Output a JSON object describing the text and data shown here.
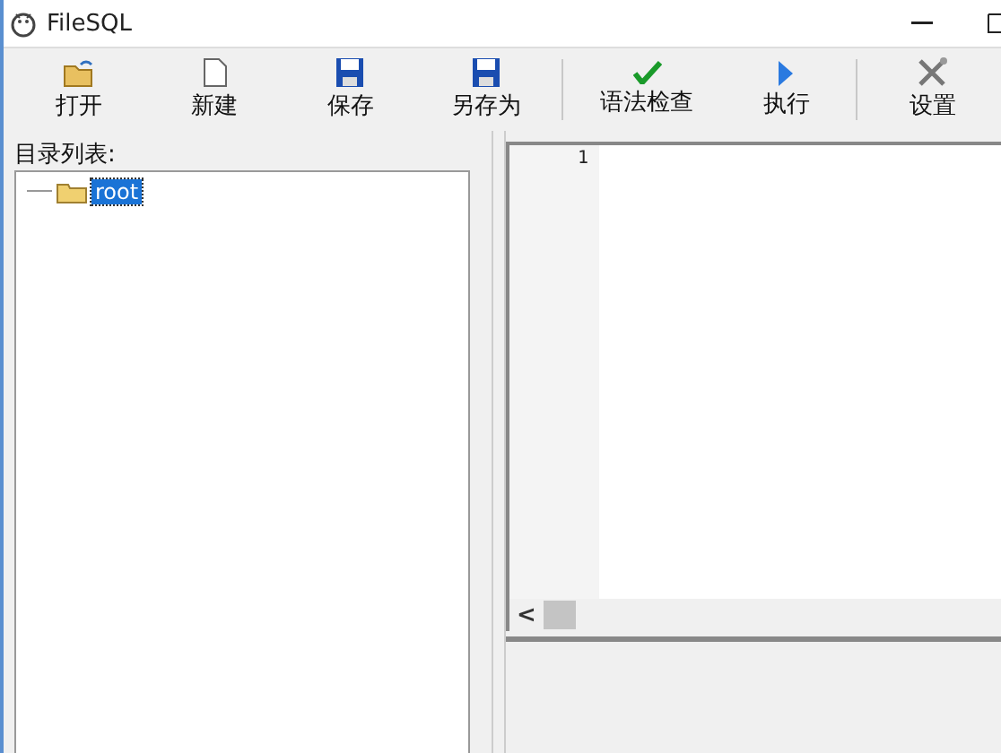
{
  "window": {
    "title": "FileSQL"
  },
  "toolbar": [
    {
      "kind": "open",
      "label": "打开"
    },
    {
      "kind": "new",
      "label": "新建"
    },
    {
      "kind": "save",
      "label": "保存"
    },
    {
      "kind": "saveas",
      "label": "另存为"
    },
    {
      "kind": "separator"
    },
    {
      "kind": "check",
      "label": "语法检查"
    },
    {
      "kind": "run",
      "label": "执行"
    },
    {
      "kind": "separator"
    },
    {
      "kind": "settings",
      "label": "设置"
    }
  ],
  "sidebar": {
    "title": "目录列表:",
    "tree": [
      {
        "label": "root",
        "selected": true
      }
    ]
  },
  "editor": {
    "line_numbers": [
      "1"
    ],
    "scroll_left": "<"
  }
}
